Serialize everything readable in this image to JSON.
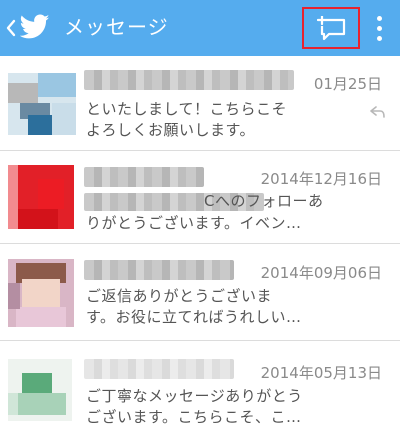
{
  "appbar": {
    "title": "メッセージ",
    "color": "#55acee",
    "icons": {
      "back": "chevron-left-icon",
      "logo": "twitter-bird-icon",
      "compose": "compose-message-icon",
      "menu": "overflow-menu-icon"
    },
    "highlight_color": "#e8232f"
  },
  "conversations": [
    {
      "date": "01月25日",
      "snippet": "といたしまして！こちらこそ\nよろしくお願いします。",
      "has_reply_indicator": true
    },
    {
      "name_suffix": "C",
      "date": "2014年12月16日",
      "snippet_prefix": "Cへのフォロー\nありがとうございます。イベン…",
      "snippet_line1": "Cへのフォローあ",
      "snippet_line2": "りがとうございます。イベン…",
      "has_reply_indicator": false
    },
    {
      "date": "2014年09月06日",
      "snippet": "ご返信ありがとうございま\nす。お役に立てればうれしい…",
      "has_reply_indicator": false
    },
    {
      "date": "2014年05月13日",
      "snippet": "ご丁寧なメッセージありがとう\nございます。こちらこそ、こ…",
      "has_reply_indicator": false
    }
  ]
}
